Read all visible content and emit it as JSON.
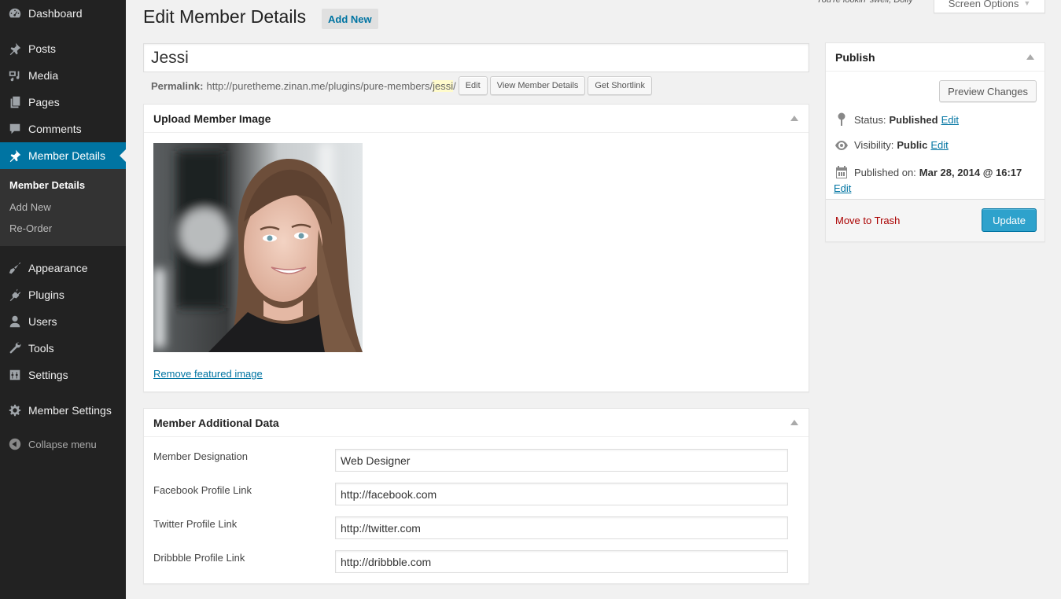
{
  "sidebar": {
    "items": [
      {
        "label": "Dashboard",
        "icon": "dashboard-icon"
      },
      {
        "label": "Posts",
        "icon": "pin-icon"
      },
      {
        "label": "Media",
        "icon": "media-icon"
      },
      {
        "label": "Pages",
        "icon": "pages-icon"
      },
      {
        "label": "Comments",
        "icon": "comment-icon"
      },
      {
        "label": "Member Details",
        "icon": "pin-icon",
        "current": true
      },
      {
        "label": "Appearance",
        "icon": "brush-icon"
      },
      {
        "label": "Plugins",
        "icon": "plug-icon"
      },
      {
        "label": "Users",
        "icon": "user-icon"
      },
      {
        "label": "Tools",
        "icon": "wrench-icon"
      },
      {
        "label": "Settings",
        "icon": "sliders-icon"
      },
      {
        "label": "Member Settings",
        "icon": "gear-icon"
      }
    ],
    "submenu": [
      {
        "label": "Member Details",
        "current": true
      },
      {
        "label": "Add New"
      },
      {
        "label": "Re-Order"
      }
    ],
    "collapse_label": "Collapse menu"
  },
  "topbar": {
    "greeting": "You're lookin' swell, Dolly",
    "screen_options": "Screen Options"
  },
  "header": {
    "title": "Edit Member Details",
    "add_new": "Add New"
  },
  "post": {
    "title": "Jessi",
    "permalink_label": "Permalink:",
    "permalink_base": "http://puretheme.zinan.me/plugins/pure-members/",
    "permalink_slug": "jessi",
    "permalink_trail": "/",
    "edit_btn": "Edit",
    "view_btn": "View Member Details",
    "shortlink_btn": "Get Shortlink"
  },
  "image_box": {
    "title": "Upload Member Image",
    "remove_link": "Remove featured image"
  },
  "data_box": {
    "title": "Member Additional Data",
    "fields": [
      {
        "label": "Member Designation",
        "value": "Web Designer"
      },
      {
        "label": "Facebook Profile Link",
        "value": "http://facebook.com"
      },
      {
        "label": "Twitter Profile Link",
        "value": "http://twitter.com"
      },
      {
        "label": "Dribbble Profile Link",
        "value": "http://dribbble.com"
      }
    ]
  },
  "publish": {
    "title": "Publish",
    "preview": "Preview Changes",
    "status_label": "Status:",
    "status_value": "Published",
    "visibility_label": "Visibility:",
    "visibility_value": "Public",
    "published_label": "Published on:",
    "published_value": "Mar 28, 2014 @ 16:17",
    "edit": "Edit",
    "trash": "Move to Trash",
    "update": "Update"
  },
  "colors": {
    "sidebar_bg": "#222222",
    "accent": "#0074a2",
    "primary_button": "#2ea2cc",
    "trash": "#aa0000"
  }
}
